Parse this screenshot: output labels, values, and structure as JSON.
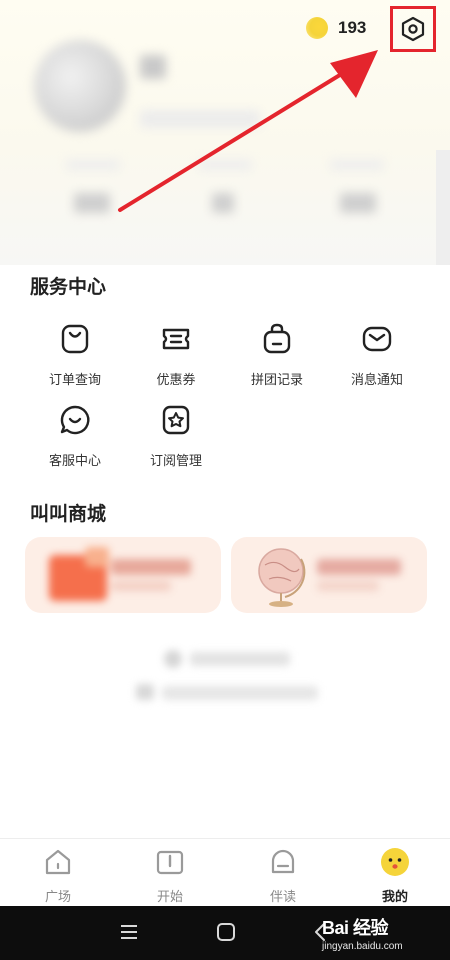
{
  "header": {
    "coin_count": "193",
    "settings_label": "设置"
  },
  "service_center": {
    "title": "服务中心",
    "items": [
      {
        "label": "订单查询",
        "icon": "shopping-bag-icon"
      },
      {
        "label": "优惠券",
        "icon": "coupon-ticket-icon"
      },
      {
        "label": "拼团记录",
        "icon": "group-bag-icon"
      },
      {
        "label": "消息通知",
        "icon": "mail-icon"
      },
      {
        "label": "客服中心",
        "icon": "chat-bubble-icon"
      },
      {
        "label": "订阅管理",
        "icon": "star-bookmark-icon"
      }
    ]
  },
  "mall": {
    "title": "叫叫商城"
  },
  "tabbar": {
    "items": [
      {
        "label": "广场",
        "icon": "home-icon",
        "active": false
      },
      {
        "label": "开始",
        "icon": "book-icon",
        "active": false
      },
      {
        "label": "伴读",
        "icon": "companion-icon",
        "active": false
      },
      {
        "label": "我的",
        "icon": "mascot-face-icon",
        "active": true
      }
    ]
  },
  "watermark": {
    "logo": "Bai 经验",
    "url": "jingyan.baidu.com"
  },
  "colors": {
    "accent_yellow": "#f5d43a",
    "highlight_red": "#e4252d",
    "card_pink": "#fdeee6",
    "text_dark": "#222222"
  }
}
